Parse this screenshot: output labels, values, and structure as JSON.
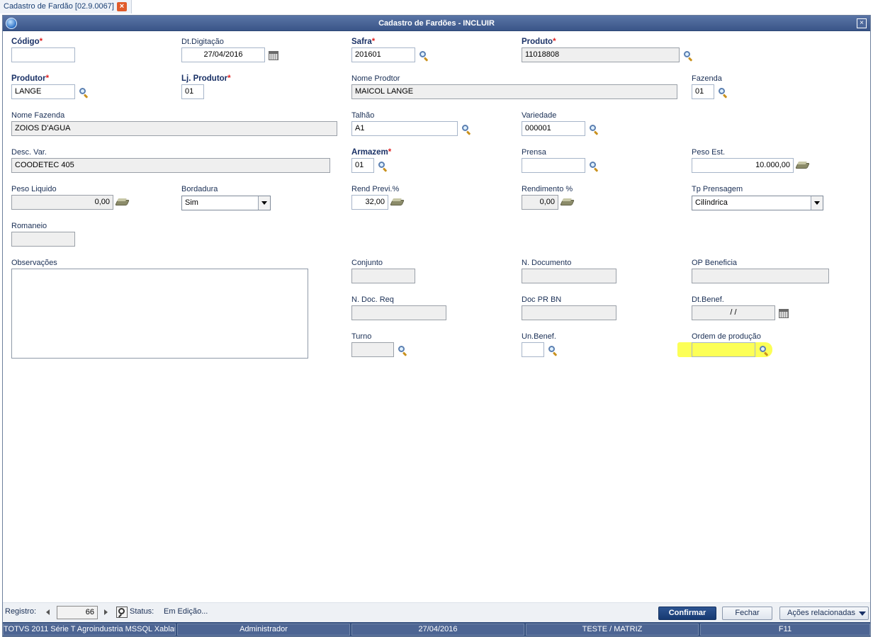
{
  "tab": {
    "label": "Cadastro de Fardão [02.9.0067]",
    "close_glyph": "×"
  },
  "window": {
    "title": "Cadastro de Fardões - INCLUIR",
    "close_glyph": "×"
  },
  "fields": {
    "codigo": {
      "label": "Código",
      "value": ""
    },
    "dt_digitacao": {
      "label": "Dt.Digitação",
      "value": "27/04/2016"
    },
    "safra": {
      "label": "Safra",
      "value": "201601"
    },
    "produto": {
      "label": "Produto",
      "value": "11018808"
    },
    "produtor": {
      "label": "Produtor",
      "value": "LANGE"
    },
    "lj_produtor": {
      "label": "Lj. Produtor",
      "value": "01"
    },
    "nome_produtor": {
      "label": "Nome Prodtor",
      "value": "MAICOL LANGE"
    },
    "fazenda": {
      "label": "Fazenda",
      "value": "01"
    },
    "nome_fazenda": {
      "label": "Nome Fazenda",
      "value": "ZOIOS D'AGUA"
    },
    "talhao": {
      "label": "Talhão",
      "value": "A1"
    },
    "variedade": {
      "label": "Variedade",
      "value": "000001"
    },
    "desc_var": {
      "label": "Desc. Var.",
      "value": "COODETEC 405"
    },
    "armazem": {
      "label": "Armazem",
      "value": "01"
    },
    "prensa": {
      "label": "Prensa",
      "value": ""
    },
    "peso_est": {
      "label": "Peso Est.",
      "value": "10.000,00"
    },
    "peso_liquido": {
      "label": "Peso Liquido",
      "value": "0,00"
    },
    "bordadura": {
      "label": "Bordadura",
      "value": "Sim"
    },
    "rend_previ": {
      "label": "Rend Previ.%",
      "value": "32,00"
    },
    "rendimento": {
      "label": "Rendimento %",
      "value": "0,00"
    },
    "tp_prensagem": {
      "label": "Tp Prensagem",
      "value": "Cilíndrica"
    },
    "romaneio": {
      "label": "Romaneio",
      "value": ""
    },
    "observacoes": {
      "label": "Observações",
      "value": ""
    },
    "conjunto": {
      "label": "Conjunto",
      "value": ""
    },
    "n_documento": {
      "label": "N. Documento",
      "value": ""
    },
    "op_beneficia": {
      "label": "OP Beneficia",
      "value": ""
    },
    "n_doc_req": {
      "label": "N. Doc. Req",
      "value": ""
    },
    "doc_pr_bn": {
      "label": "Doc PR BN",
      "value": ""
    },
    "dt_benef": {
      "label": "Dt.Benef.",
      "value": "/ /"
    },
    "turno": {
      "label": "Turno",
      "value": ""
    },
    "un_benef": {
      "label": "Un.Benef.",
      "value": ""
    },
    "ordem_producao": {
      "label": "Ordem de produção",
      "value": ""
    }
  },
  "required_marker": "*",
  "footer": {
    "registro_label": "Registro:",
    "registro_value": "66",
    "status_label": "Status:",
    "status_value": "Em Edição...",
    "confirm_label": "Confirmar",
    "close_label": "Fechar",
    "actions_label": "Ações relacionadas"
  },
  "statusbar": {
    "system": "TOTVS 2011 Série T Agroindustria MSSQL Xablau",
    "user": "Administrador",
    "date": "27/04/2016",
    "company": "TESTE / MATRIZ",
    "key": "F11"
  },
  "colors": {
    "title_bar": "#3a5588",
    "required": "#e02020",
    "highlight": "#fbff3a",
    "primary_button": "#173a72"
  }
}
